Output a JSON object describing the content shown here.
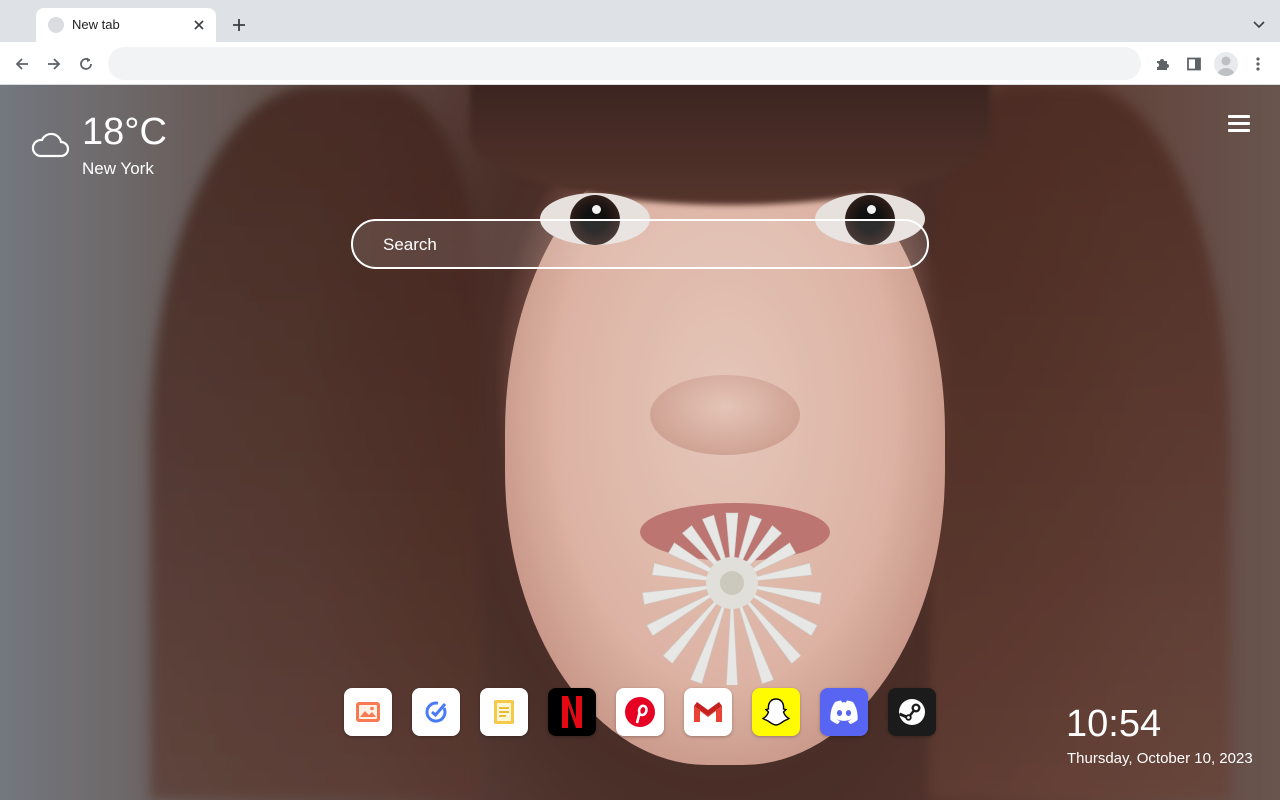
{
  "browser": {
    "tab": {
      "title": "New tab"
    },
    "omnibox": {
      "value": ""
    }
  },
  "weather": {
    "temperature": "18°C",
    "city": "New York",
    "icon": "cloud-icon"
  },
  "search": {
    "placeholder": "Search"
  },
  "dock": {
    "apps": [
      {
        "name": "Photos",
        "icon": "photos-icon",
        "color": "#ffffff"
      },
      {
        "name": "Tasks",
        "icon": "tasks-icon",
        "color": "#ffffff"
      },
      {
        "name": "Notes",
        "icon": "notes-icon",
        "color": "#ffffff"
      },
      {
        "name": "Netflix",
        "icon": "netflix-icon",
        "color": "#000000"
      },
      {
        "name": "Pinterest",
        "icon": "pinterest-icon",
        "color": "#ffffff"
      },
      {
        "name": "Gmail",
        "icon": "gmail-icon",
        "color": "#ffffff"
      },
      {
        "name": "Snapchat",
        "icon": "snapchat-icon",
        "color": "#fffc00"
      },
      {
        "name": "Discord",
        "icon": "discord-icon",
        "color": "#5865f2"
      },
      {
        "name": "Steam",
        "icon": "steam-icon",
        "color": "#1b1b1b"
      }
    ]
  },
  "clock": {
    "time": "10:54",
    "date": "Thursday, October 10, 2023"
  }
}
